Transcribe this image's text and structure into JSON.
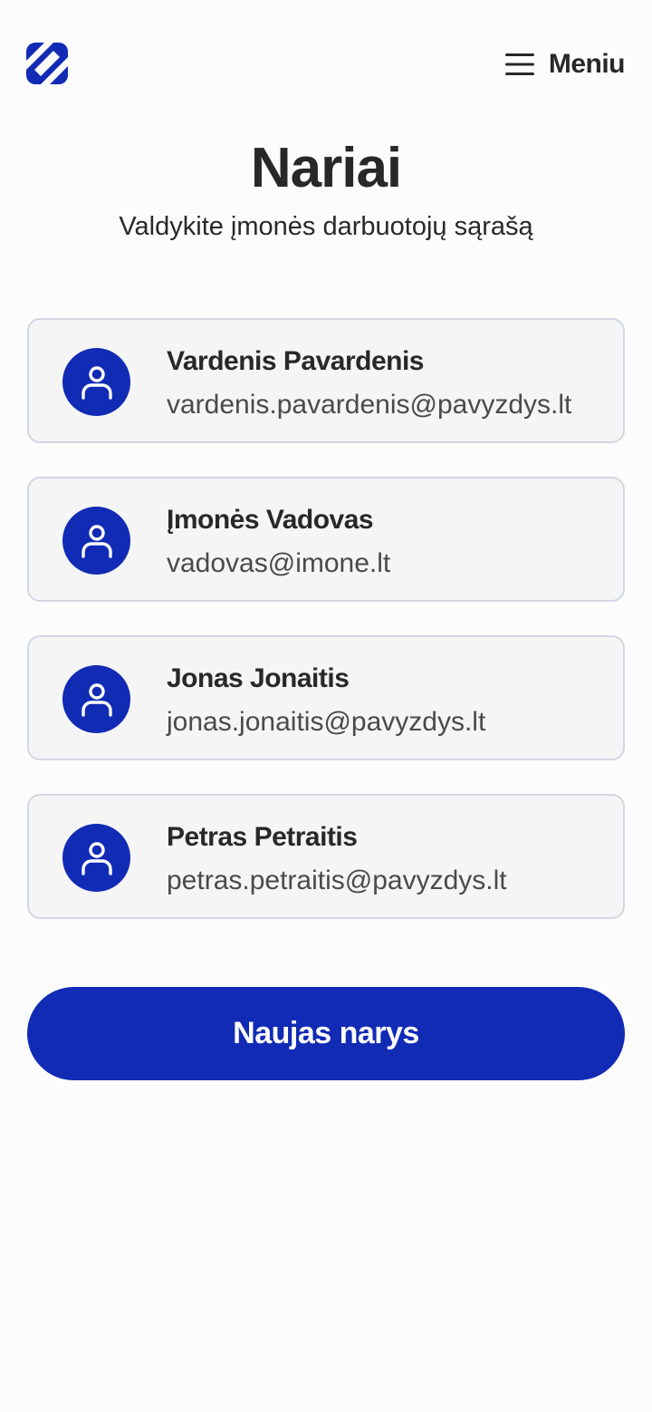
{
  "header": {
    "logo_icon": "brand-logo-icon",
    "menu_icon": "hamburger-menu-icon",
    "menu_label": "Meniu"
  },
  "page": {
    "title": "Nariai",
    "subtitle": "Valdykite įmonės darbuotojų sąrašą"
  },
  "members": [
    {
      "name": "Vardenis Pavardenis",
      "email": "vardenis.pavardenis@pavyzdys.lt",
      "icon": "user-icon"
    },
    {
      "name": "Įmonės Vadovas",
      "email": "vadovas@imone.lt",
      "icon": "user-icon"
    },
    {
      "name": "Jonas Jonaitis",
      "email": "jonas.jonaitis@pavyzdys.lt",
      "icon": "user-icon"
    },
    {
      "name": "Petras Petraitis",
      "email": "petras.petraitis@pavyzdys.lt",
      "icon": "user-icon"
    }
  ],
  "actions": {
    "new_member_label": "Naujas narys"
  },
  "colors": {
    "brand": "#112bb5",
    "text": "#282828",
    "card_bg": "#f5f5f5",
    "card_border": "#d3d7e3"
  }
}
